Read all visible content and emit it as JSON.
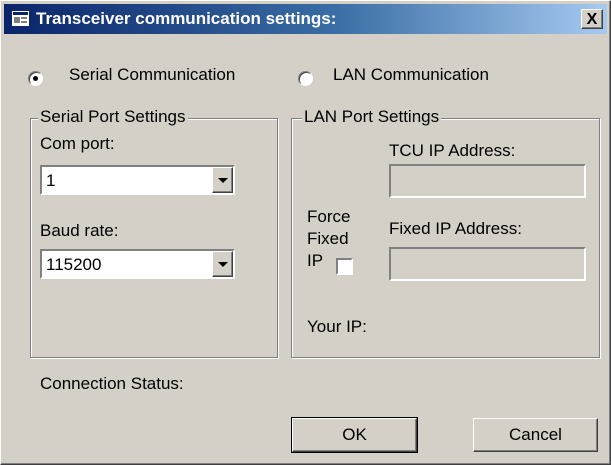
{
  "window": {
    "title": "Transceiver communication settings:",
    "close_label": "X"
  },
  "mode": {
    "serial_label": "Serial Communication",
    "lan_label": "LAN Communication",
    "selected": "serial"
  },
  "serial_group": {
    "title": "Serial Port Settings",
    "com_port_label": "Com port:",
    "com_port_value": "1",
    "baud_rate_label": "Baud rate:",
    "baud_rate_value": "115200"
  },
  "lan_group": {
    "title": "LAN Port Settings",
    "tcu_ip_label": "TCU  IP Address:",
    "tcu_ip_value": "",
    "force_fixed_line1": "Force",
    "force_fixed_line2": "Fixed",
    "force_fixed_line3": "IP",
    "force_fixed_checked": false,
    "fixed_ip_label": "Fixed IP Address:",
    "fixed_ip_value": "",
    "your_ip_label": "Your IP:"
  },
  "status": {
    "label": "Connection Status:"
  },
  "buttons": {
    "ok": "OK",
    "cancel": "Cancel"
  }
}
